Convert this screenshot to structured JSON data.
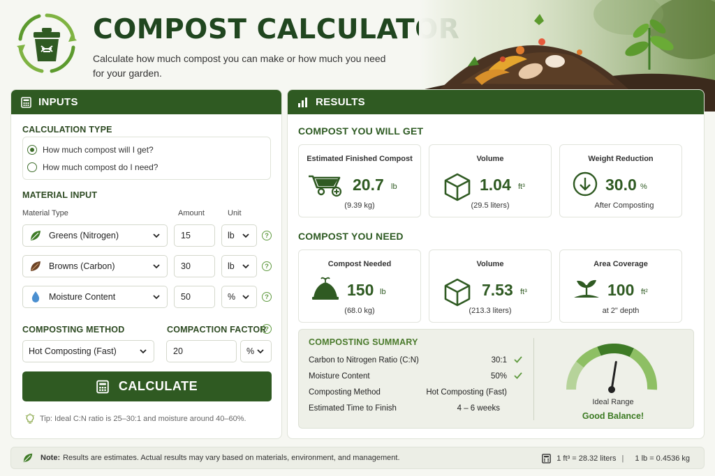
{
  "app": {
    "title": "COMPOST CALCULATOR",
    "subtitle": "Calculate how much compost you can make or how much you need for your garden."
  },
  "inputs": {
    "header": "INPUTS",
    "calc_type_label": "CALCULATION TYPE",
    "calc_type_options": [
      "How much compost will I get?",
      "How much compost do I need?"
    ],
    "calc_type_selected": 0,
    "material_input_label": "MATERIAL INPUT",
    "col_type": "Material Type",
    "col_amount": "Amount",
    "col_unit": "Unit",
    "materials": [
      {
        "type": "Greens (Nitrogen)",
        "amount": "15",
        "unit": "lb",
        "icon": "leaf-icon",
        "color": "#3e7b26"
      },
      {
        "type": "Browns (Carbon)",
        "amount": "30",
        "unit": "lb",
        "icon": "dry-leaf-icon",
        "color": "#6b4226"
      },
      {
        "type": "Moisture Content",
        "amount": "50",
        "unit": "%",
        "icon": "water-drop-icon",
        "color": "#4a8fd0"
      }
    ],
    "method_label": "COMPOSTING METHOD",
    "method_value": "Hot Composting (Fast)",
    "compaction_label": "COMPACTION FACTOR",
    "compaction_value": "20",
    "compaction_unit": "%",
    "calculate_label": "CALCULATE",
    "tip": "Tip: Ideal C:N ratio is 25–30:1 and moisture around 40–60%."
  },
  "results": {
    "header": "RESULTS",
    "get_title": "COMPOST YOU WILL GET",
    "get_cards": [
      {
        "title": "Estimated Finished Compost",
        "value": "20.7",
        "unit": "lb",
        "sub": "(9.39 kg)",
        "icon": "wheelbarrow-icon"
      },
      {
        "title": "Volume",
        "value": "1.04",
        "unit": "ft³",
        "sub": "(29.5 liters)",
        "icon": "cube-icon"
      },
      {
        "title": "Weight Reduction",
        "value": "30.0",
        "unit": "%",
        "sub": "After Composting",
        "icon": "arrow-down-circle-icon"
      }
    ],
    "need_title": "COMPOST YOU NEED",
    "need_cards": [
      {
        "title": "Compost Needed",
        "value": "150",
        "unit": "lb",
        "sub": "(68.0 kg)",
        "icon": "compost-pile-icon"
      },
      {
        "title": "Volume",
        "value": "7.53",
        "unit": "ft³",
        "sub": "(213.3 liters)",
        "icon": "cube-icon"
      },
      {
        "title": "Area Coverage",
        "value": "100",
        "unit": "ft²",
        "sub": "at 2\" depth",
        "icon": "sprout-icon"
      }
    ],
    "summary": {
      "title": "COMPOSTING SUMMARY",
      "rows": [
        {
          "label": "Carbon to Nitrogen Ratio (C:N)",
          "value": "30:1",
          "check": true
        },
        {
          "label": "Moisture Content",
          "value": "50%",
          "check": true
        },
        {
          "label": "Composting Method",
          "value": "Hot Composting (Fast)",
          "check": false
        },
        {
          "label": "Estimated Time to Finish",
          "value": "4 – 6 weeks",
          "check": false
        }
      ],
      "gauge_label": "Ideal Range",
      "gauge_status": "Good Balance!",
      "gauge_level": 0.55
    }
  },
  "footer": {
    "note_label": "Note:",
    "note_text": "Results are estimates. Actual results may vary based on materials, environment, and management.",
    "conv1": "1 ft³ = 28.32 liters",
    "sep": "|",
    "conv2": "1 lb = 0.4536 kg"
  },
  "colors": {
    "primary": "#2f5a22",
    "accent": "#5f9a3f",
    "light": "#eef0e8"
  }
}
